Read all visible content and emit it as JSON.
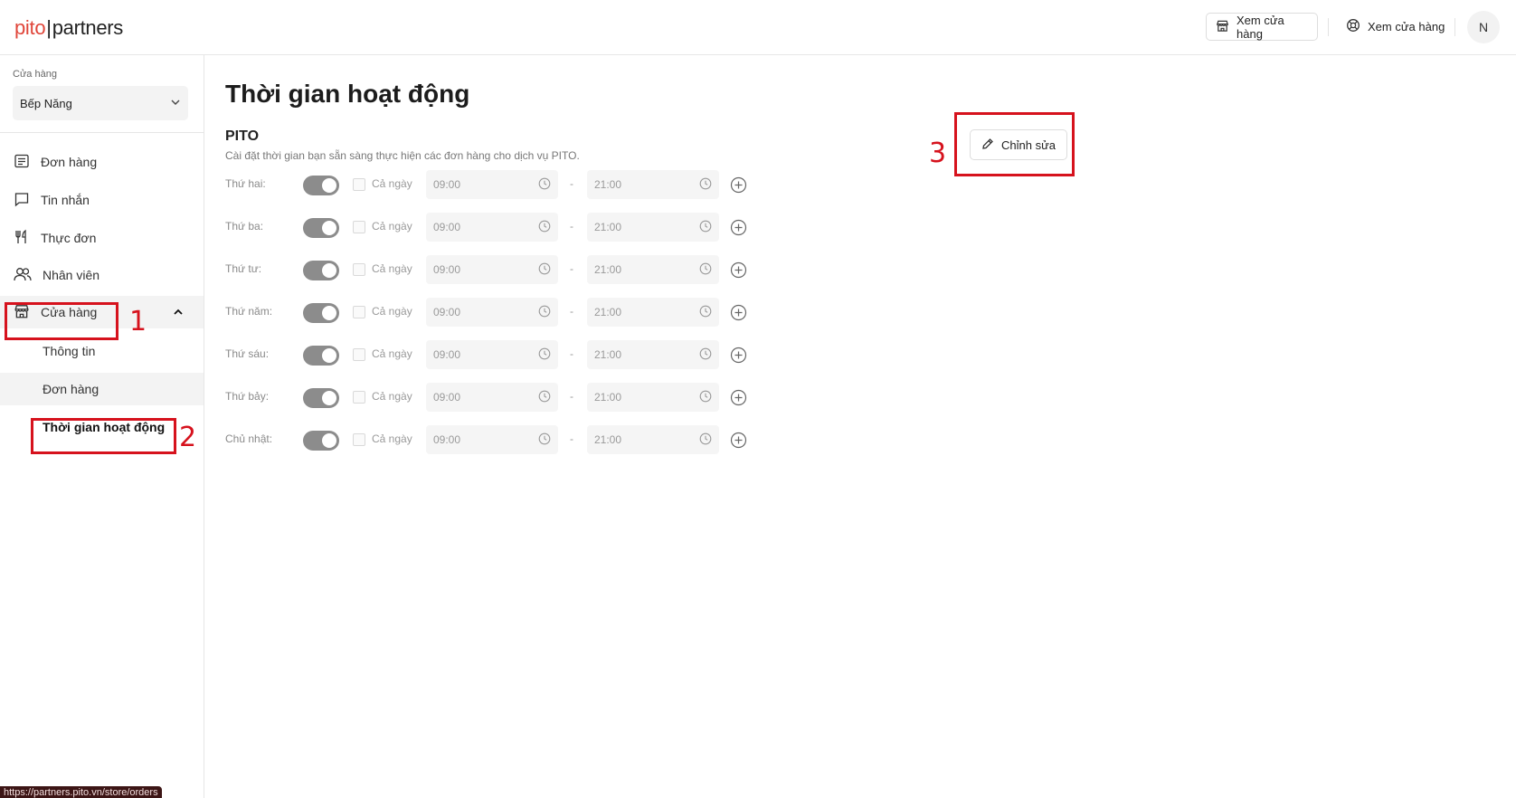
{
  "header": {
    "logo_left": "pito",
    "logo_sep": "|",
    "logo_right": "partners",
    "btn_store_view": "Xem cửa hàng",
    "btn_store_view_2": "Xem cửa hàng",
    "avatar_initial": "N"
  },
  "sidebar": {
    "store_label": "Cửa hàng",
    "store_selected": "Bếp Năng",
    "nav": [
      {
        "label": "Đơn hàng",
        "icon": "list-icon"
      },
      {
        "label": "Tin nhắn",
        "icon": "message-icon"
      },
      {
        "label": "Thực đơn",
        "icon": "utensils-icon"
      },
      {
        "label": "Nhân viên",
        "icon": "users-icon"
      },
      {
        "label": "Cửa hàng",
        "icon": "store-icon"
      }
    ],
    "sub": [
      {
        "label": "Thông tin"
      },
      {
        "label": "Đơn hàng"
      },
      {
        "label": "Thời gian hoạt động"
      }
    ],
    "status_url": "https://partners.pito.vn/store/orders"
  },
  "main": {
    "title": "Thời gian hoạt động",
    "section_title": "PITO",
    "section_desc": "Cài đặt thời gian bạn sẵn sàng thực hiện các đơn hàng cho dịch vụ PITO.",
    "edit_label": "Chỉnh sửa",
    "allday_label": "Cả ngày",
    "dash": "-",
    "days": [
      {
        "day": "Thứ hai:",
        "start": "09:00",
        "end": "21:00",
        "enabled": true,
        "all_day": false
      },
      {
        "day": "Thứ ba:",
        "start": "09:00",
        "end": "21:00",
        "enabled": true,
        "all_day": false
      },
      {
        "day": "Thứ tư:",
        "start": "09:00",
        "end": "21:00",
        "enabled": true,
        "all_day": false
      },
      {
        "day": "Thứ năm:",
        "start": "09:00",
        "end": "21:00",
        "enabled": true,
        "all_day": false
      },
      {
        "day": "Thứ sáu:",
        "start": "09:00",
        "end": "21:00",
        "enabled": true,
        "all_day": false
      },
      {
        "day": "Thứ bảy:",
        "start": "09:00",
        "end": "21:00",
        "enabled": true,
        "all_day": false
      },
      {
        "day": "Chủ nhật:",
        "start": "09:00",
        "end": "21:00",
        "enabled": true,
        "all_day": false
      }
    ]
  },
  "annotations": [
    {
      "label": "1"
    },
    {
      "label": "2"
    },
    {
      "label": "3"
    }
  ],
  "colors": {
    "brand_red": "#e0463a",
    "annotation_red": "#d6121d",
    "toggle_gray": "#8c8c8c"
  }
}
